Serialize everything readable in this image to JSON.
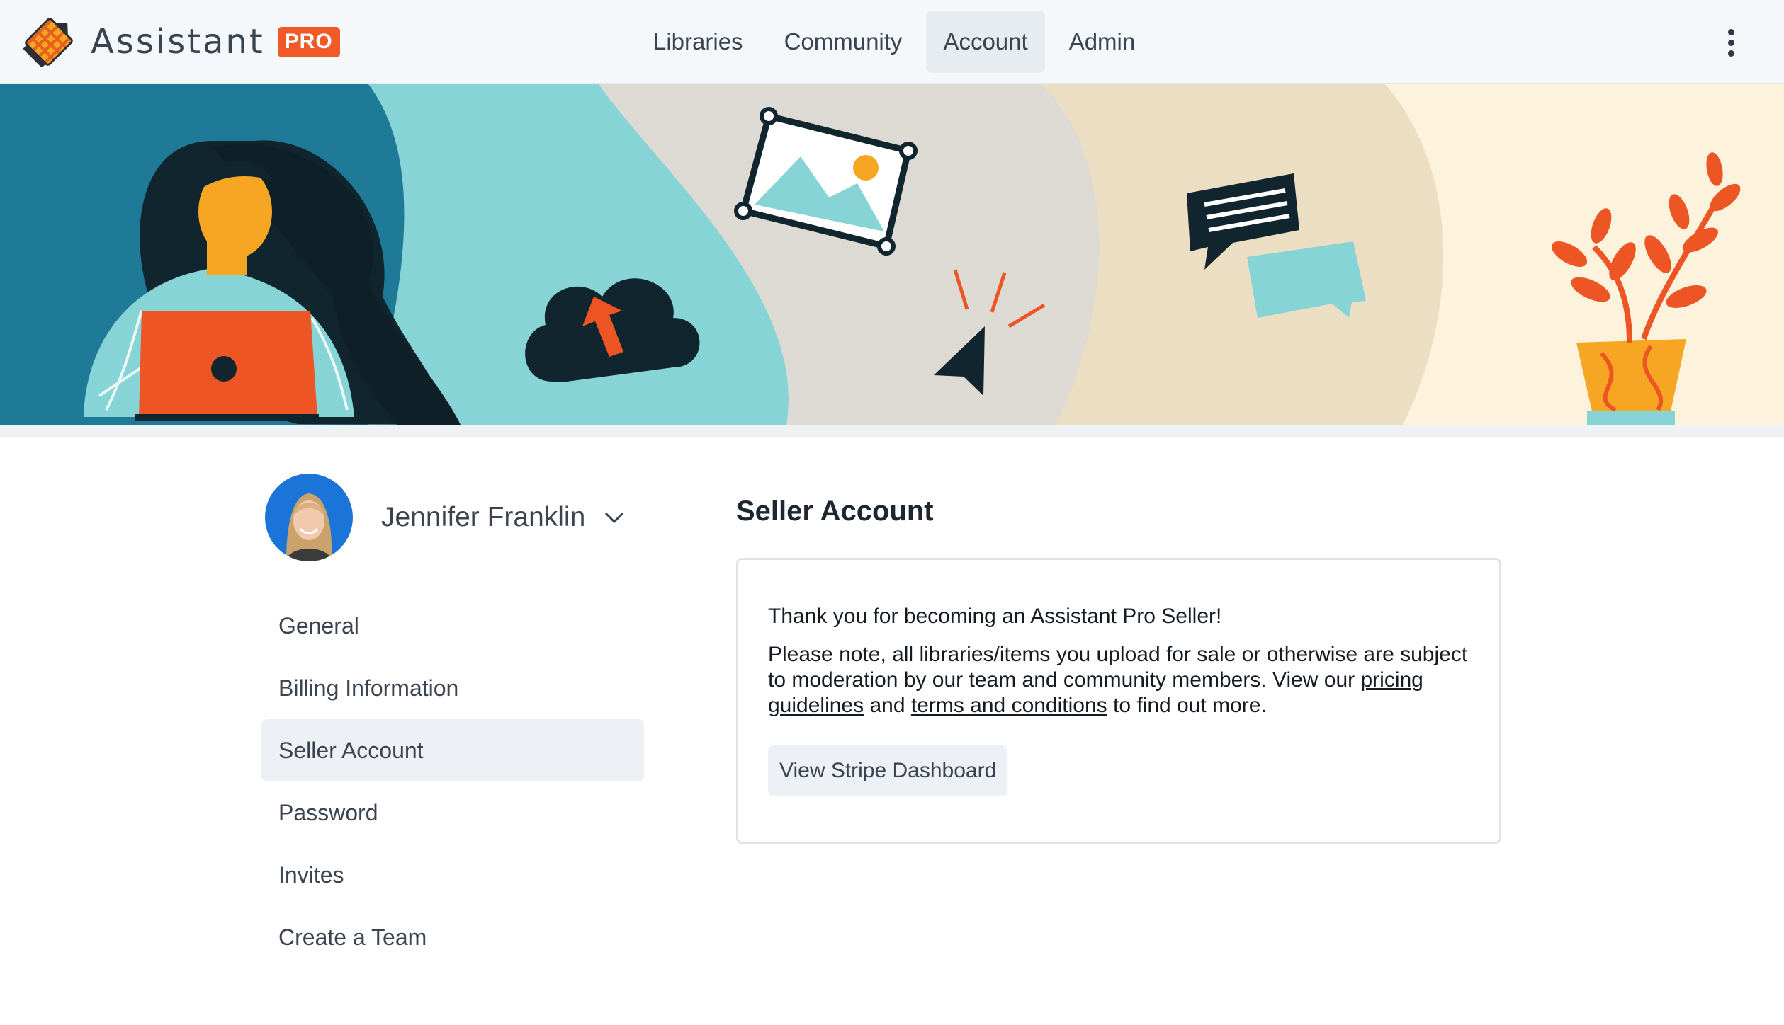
{
  "brand": {
    "name": "Assistant",
    "badge": "PRO"
  },
  "nav": {
    "items": [
      {
        "label": "Libraries"
      },
      {
        "label": "Community"
      },
      {
        "label": "Account",
        "active": true
      },
      {
        "label": "Admin"
      }
    ]
  },
  "colors": {
    "accent": "#f05a28",
    "nav_active_bg": "#e6ecf0",
    "banner_teal_dark": "#1e7a96",
    "banner_teal_light": "#86d4d6",
    "banner_grey": "#dcdad2",
    "banner_sand": "#ebdec3",
    "banner_cream": "#fdf3dd"
  },
  "profile": {
    "name": "Jennifer Franklin"
  },
  "sidebar": {
    "items": [
      {
        "label": "General"
      },
      {
        "label": "Billing Information"
      },
      {
        "label": "Seller Account",
        "active": true
      },
      {
        "label": "Password"
      },
      {
        "label": "Invites"
      },
      {
        "label": "Create a Team"
      }
    ]
  },
  "main": {
    "title": "Seller Account",
    "thanks": "Thank you for becoming an Assistant Pro Seller!",
    "note_before": "Please note, all libraries/items you upload for sale or otherwise are subject to moderation by our team and community members. View our ",
    "link_pricing": "pricing guidelines",
    "note_and": " and ",
    "link_terms": "terms and conditions",
    "note_after": " to find out more.",
    "button_label": "View Stripe Dashboard"
  },
  "icons": {
    "logo": "pencil-grid-logo",
    "menu": "kebab-menu-icon",
    "profile_toggle": "chevron-down-icon"
  }
}
